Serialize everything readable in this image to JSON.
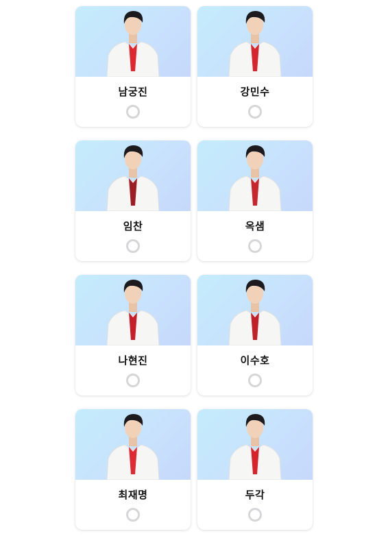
{
  "accent": {
    "photo_gradient": [
      "#c4ecfc",
      "#c6d8fb"
    ],
    "radio_border": "#d6d6d8"
  },
  "candidates": [
    {
      "name": "남궁진",
      "selected": false,
      "photo": "singer-photo"
    },
    {
      "name": "강민수",
      "selected": false,
      "photo": "singer-photo"
    },
    {
      "name": "임찬",
      "selected": false,
      "photo": "singer-photo"
    },
    {
      "name": "옥샘",
      "selected": false,
      "photo": "singer-photo"
    },
    {
      "name": "나현진",
      "selected": false,
      "photo": "singer-photo"
    },
    {
      "name": "이수호",
      "selected": false,
      "photo": "singer-photo"
    },
    {
      "name": "최재명",
      "selected": false,
      "photo": "singer-photo"
    },
    {
      "name": "두각",
      "selected": false,
      "photo": "singer-photo"
    }
  ]
}
